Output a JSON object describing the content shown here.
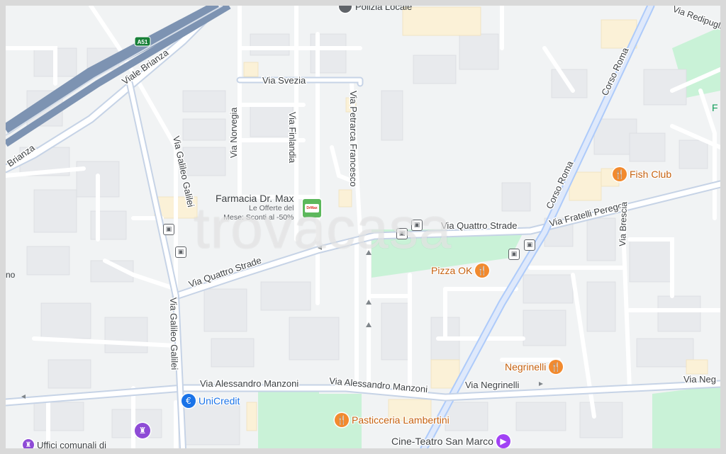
{
  "map": {
    "watermark": "trovacasa",
    "highway_shield": "A51",
    "streets": {
      "viale_brianza": "Viale Brianza",
      "brianza_left": "Brianza",
      "via_svezia": "Via Svezia",
      "via_norvegia": "Via Norvegia",
      "via_finlandia": "Via Finlandia",
      "via_petrarca": "Via Petrarca Francesco",
      "via_galileo_1": "Via Galileo Galilei",
      "via_galileo_2": "Via Galileo Galilei",
      "via_quattro_strade_w": "Via Quattro Strade",
      "via_quattro_strade_e": "Via Quattro Strade",
      "corso_roma_n": "Corso Roma",
      "corso_roma_s": "Corso Roma",
      "via_redipuglia": "Via Redipuglia",
      "via_fratelli_perego": "Via Fratelli Perego",
      "via_brescia": "Via Brescia",
      "via_manzoni_w": "Via Alessandro Manzoni",
      "via_manzoni_e": "Via Alessandro Manzoni",
      "via_negrinelli": "Via Negrinelli",
      "via_neg_cut": "Via Neg"
    },
    "pois": {
      "polizia": "Polizia Locale",
      "pharmacy_name": "Farmacia Dr. Max",
      "pharmacy_promo_1": "Le Offerte del",
      "pharmacy_promo_2": "Mese: Sconti al -50%",
      "pharmacy_logo_text": "DrMax",
      "fish_club": "Fish Club",
      "pizza_ok": "Pizza OK",
      "negrinelli": "Negrinelli",
      "pasticceria": "Pasticceria Lambertini",
      "unicredit": "UniCredit",
      "cinema": "Cine-Teatro San Marco",
      "uffici": "Uffici comunali di",
      "left_cut": "no",
      "right_cut": "F"
    },
    "icons": {
      "food": "fork-knife-icon",
      "bank": "euro-icon",
      "cinema": "film-icon",
      "bus": "bus-stop-icon",
      "townhall": "building-icon",
      "police": "police-icon"
    },
    "colors": {
      "background": "#f1f3f4",
      "road": "#ffffff",
      "road_major": "#aecbfa",
      "highway": "#7d93b2",
      "park": "#c9f2d7",
      "building": "#e8eaed",
      "food_accent": "#f28a2e",
      "bank_accent": "#1a73e8",
      "cinema_accent": "#a142f4",
      "pharmacy_accent": "#5cb85c"
    }
  }
}
